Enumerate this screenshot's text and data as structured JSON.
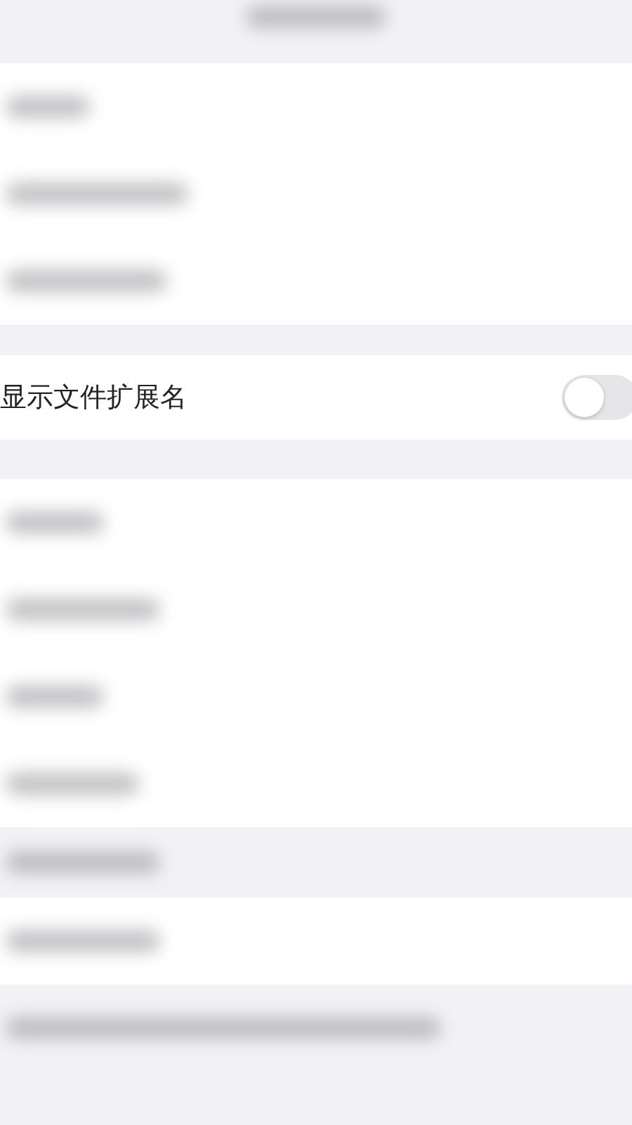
{
  "sections": [
    {
      "kind": "blurred",
      "rows": [
        {
          "kind": "blurred"
        },
        {
          "kind": "blurred"
        },
        {
          "kind": "blurred"
        }
      ]
    },
    {
      "kind": "setting",
      "label": "显示文件扩展名",
      "on": false
    },
    {
      "kind": "blurred",
      "rows": [
        {
          "kind": "blurred"
        },
        {
          "kind": "blurred"
        },
        {
          "kind": "blurred"
        },
        {
          "kind": "blurred"
        }
      ]
    },
    {
      "kind": "blurred",
      "rows": [
        {
          "kind": "blurred"
        }
      ]
    }
  ]
}
